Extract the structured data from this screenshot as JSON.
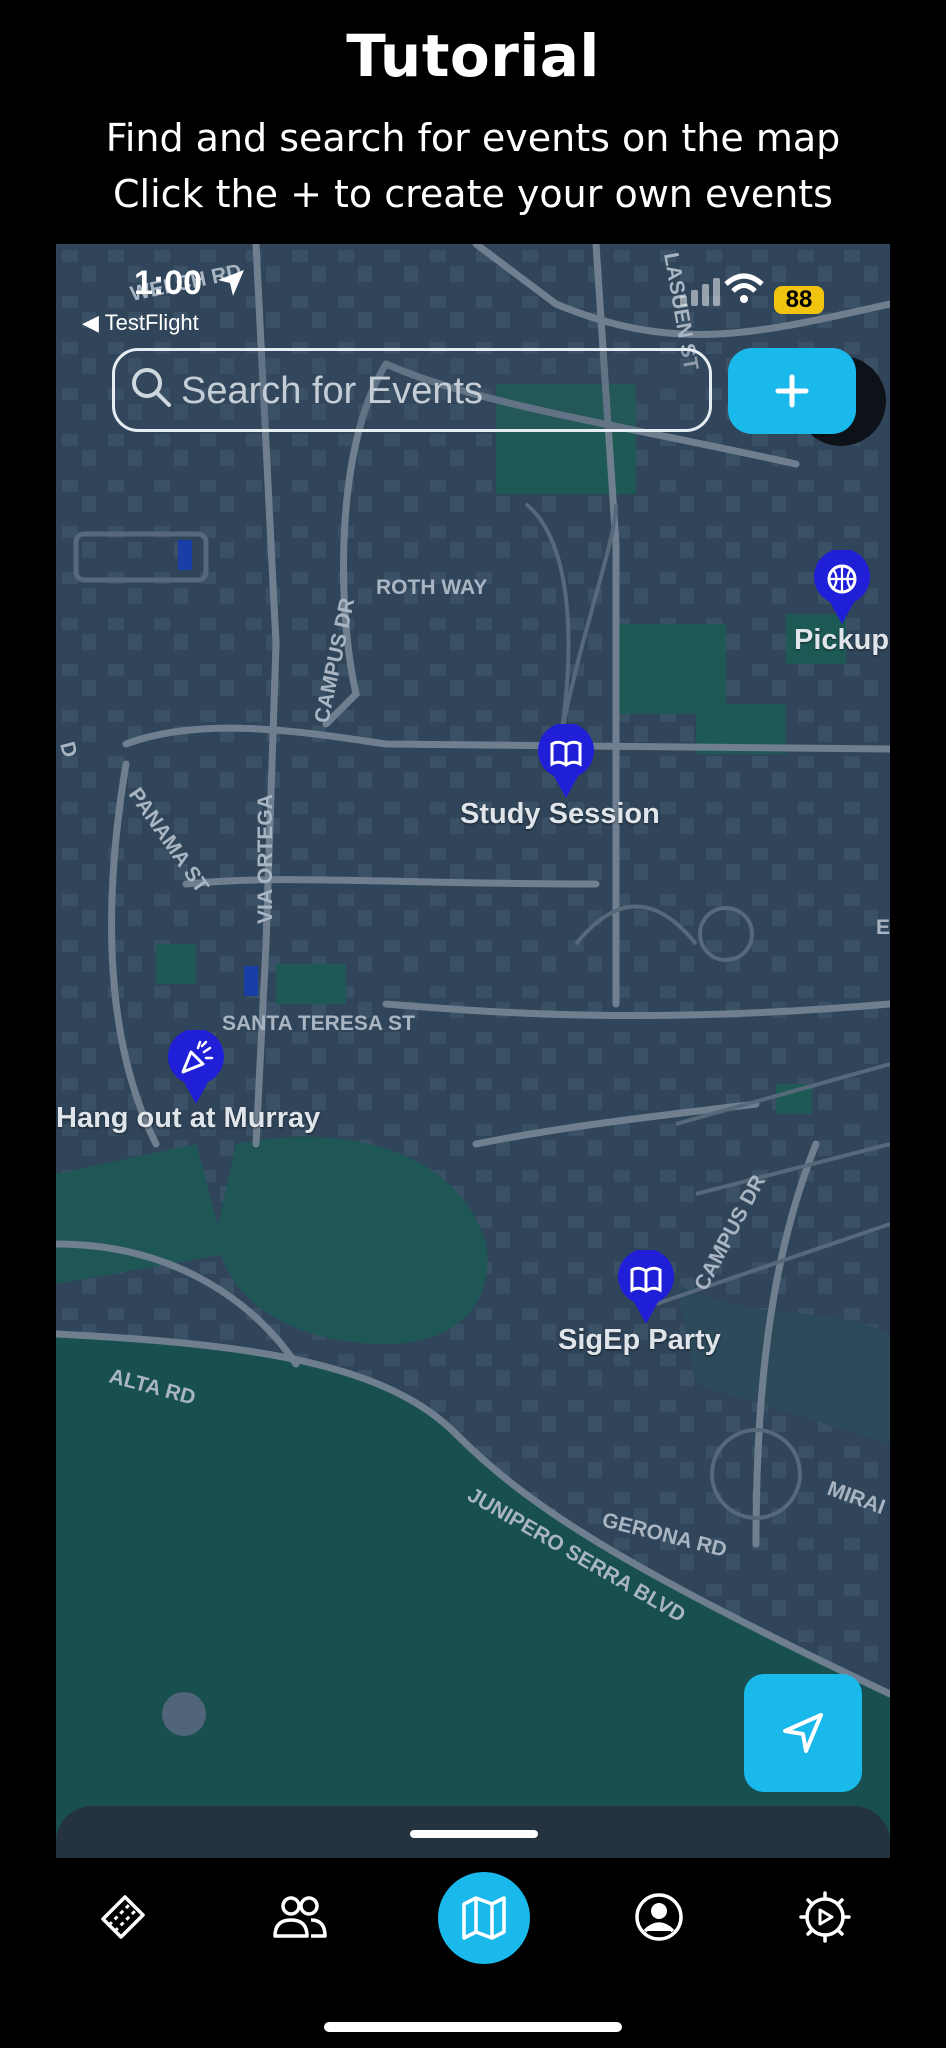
{
  "tutorial": {
    "title": "Tutorial",
    "line1": "Find and search for events on the map",
    "line2": "Click the + to create your own events"
  },
  "status": {
    "time": "1:00",
    "back_label": "◀ TestFlight",
    "battery": "88"
  },
  "search": {
    "placeholder": "Search for Events"
  },
  "events": [
    {
      "label": "Study Session",
      "icon": "book-icon"
    },
    {
      "label": "Hang out at Murray",
      "icon": "party-popper-icon"
    },
    {
      "label": "SigEp Party",
      "icon": "book-icon"
    },
    {
      "label": "Pickup",
      "icon": "basketball-icon"
    }
  ],
  "streets": {
    "roth_way": "ROTH WAY",
    "campus_dr_1": "CAMPUS DR",
    "campus_dr_2": "CAMPUS DR",
    "panama_st": "PANAMA ST",
    "via_ortega": "VIA ORTEGA",
    "santa_teresa": "SANTA TERESA ST",
    "alta_rd": "ALTA RD",
    "junipero": "JUNIPERO SERRA BLVD",
    "gerona": "GERONA RD",
    "welch": "WELCH RD",
    "lasuen": "LASUEN ST",
    "mirada": "MIRAI",
    "e_edge": "E",
    "d_edge": "D"
  },
  "tabs": [
    "tickets-icon",
    "friends-icon",
    "map-icon",
    "profile-icon",
    "settings-icon"
  ],
  "colors": {
    "accent": "#19b9ec",
    "pin": "#1f1fd8",
    "map_bg": "#2e4256",
    "park": "#17504f"
  }
}
